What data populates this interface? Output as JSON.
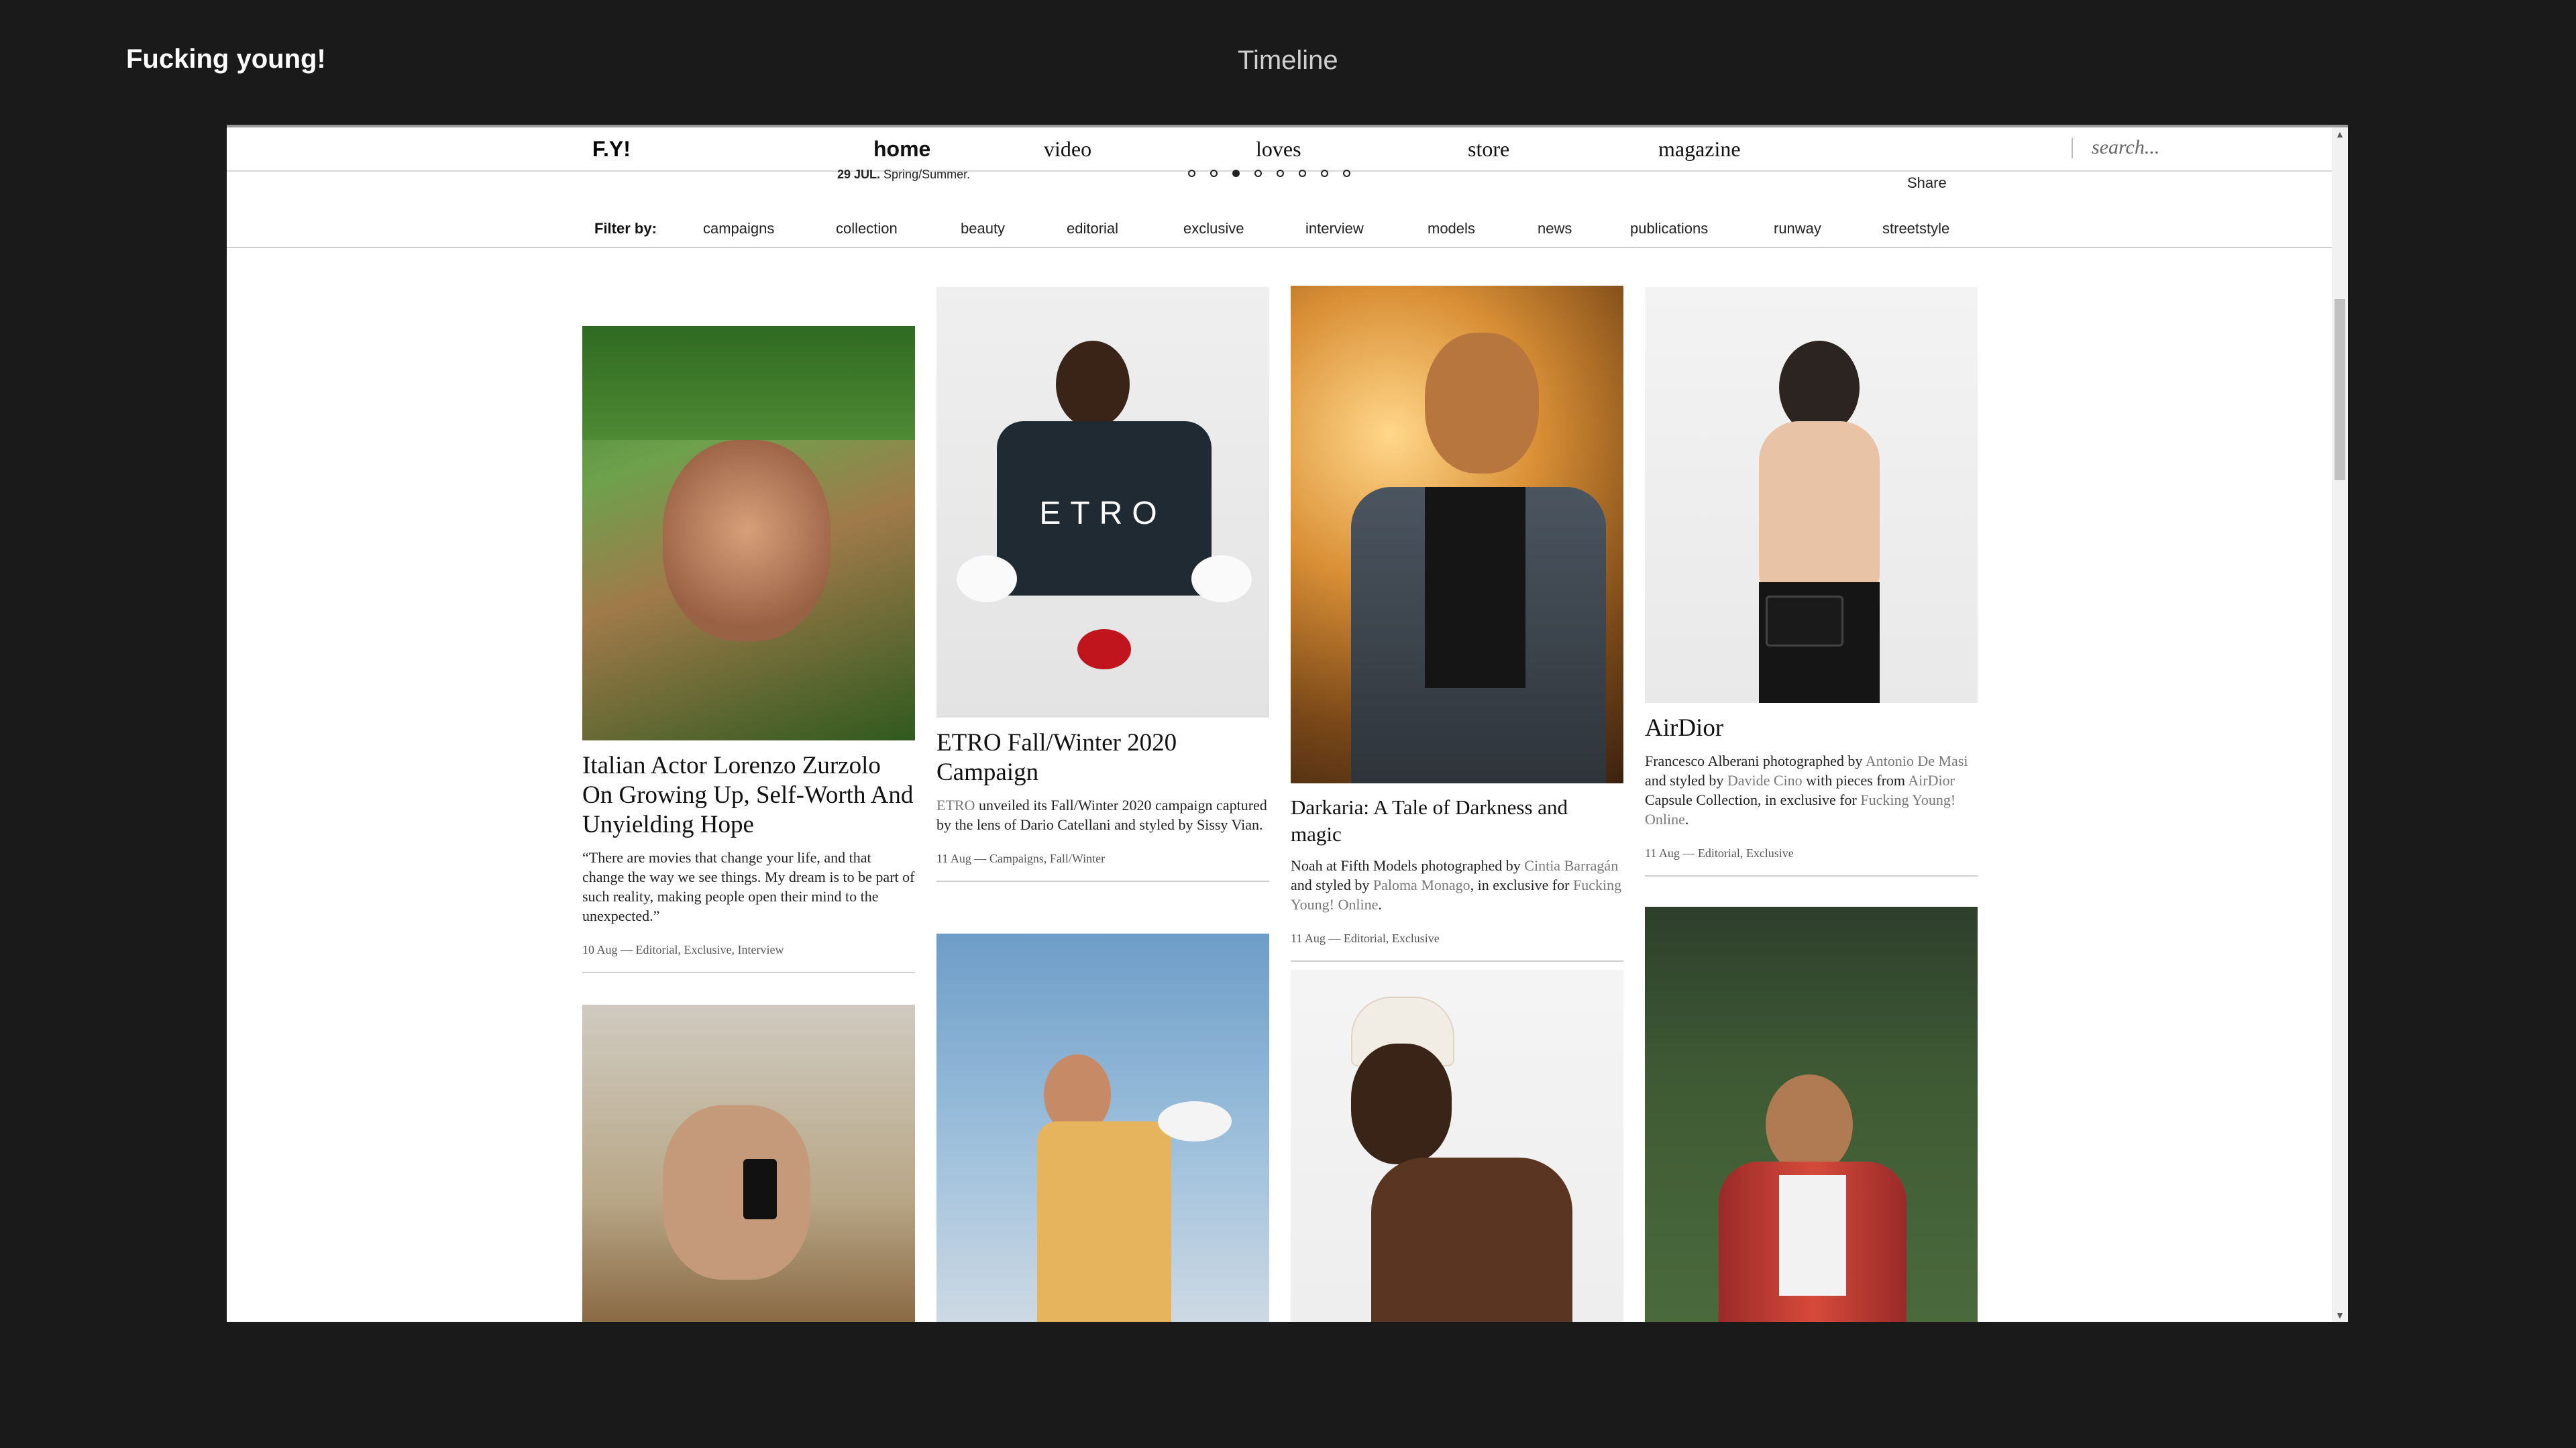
{
  "outer": {
    "app_title": "Fucking young!",
    "center_title": "Timeline"
  },
  "nav": {
    "logo": "F.Y!",
    "links": [
      "home",
      "video",
      "loves",
      "store",
      "magazine"
    ],
    "search_placeholder": "search...",
    "date_bold": "29 JUL.",
    "date_text": "Spring/Summer.",
    "share": "Share",
    "active_dot": 2
  },
  "filters": {
    "label": "Filter by:",
    "items": [
      "campaigns",
      "collection",
      "beauty",
      "editorial",
      "exclusive",
      "interview",
      "models",
      "news",
      "publications",
      "runway",
      "streetstyle"
    ]
  },
  "cards": [
    {
      "title": "Italian Actor Lorenzo Zurzolo On Growing Up, Self-Worth And Unyielding Hope",
      "text": "“There are movies that change your life, and that change the way we see things. My dream is to be part of such reality, making people open their mind to the unexpected.”",
      "meta": "10 Aug — Editorial, Exclusive, Interview"
    },
    {
      "title": "ETRO Fall/Winter 2020 Campaign",
      "text_link": "ETRO",
      "text": " unveiled its Fall/Winter 2020 campaign captured by the lens of Dario Catellani and styled by Sissy Vian.",
      "meta": "11 Aug — Campaigns, Fall/Winter",
      "image_label": "ETRO"
    },
    {
      "title": "Darkaria: A Tale of Darkness and magic",
      "text_a": "Noah at Fifth Models photographed by ",
      "link_a": "Cintia Barragán",
      "text_b": " and styled by ",
      "link_b": "Paloma Monago",
      "text_c": ", in exclusive for ",
      "link_c": "Fucking Young! Online",
      "text_d": ".",
      "meta": "11 Aug — Editorial, Exclusive"
    },
    {
      "title": "AirDior",
      "text_a": "Francesco Alberani photographed by ",
      "link_a": "Antonio De Masi",
      "text_b": " and styled by ",
      "link_b": "Davide Cino",
      "text_c": " with pieces from ",
      "link_c": "AirDior",
      "text_d": " Capsule Collection, in exclusive for ",
      "link_d": "Fucking Young! Online",
      "text_e": ".",
      "meta": "11 Aug — Editorial, Exclusive"
    }
  ]
}
